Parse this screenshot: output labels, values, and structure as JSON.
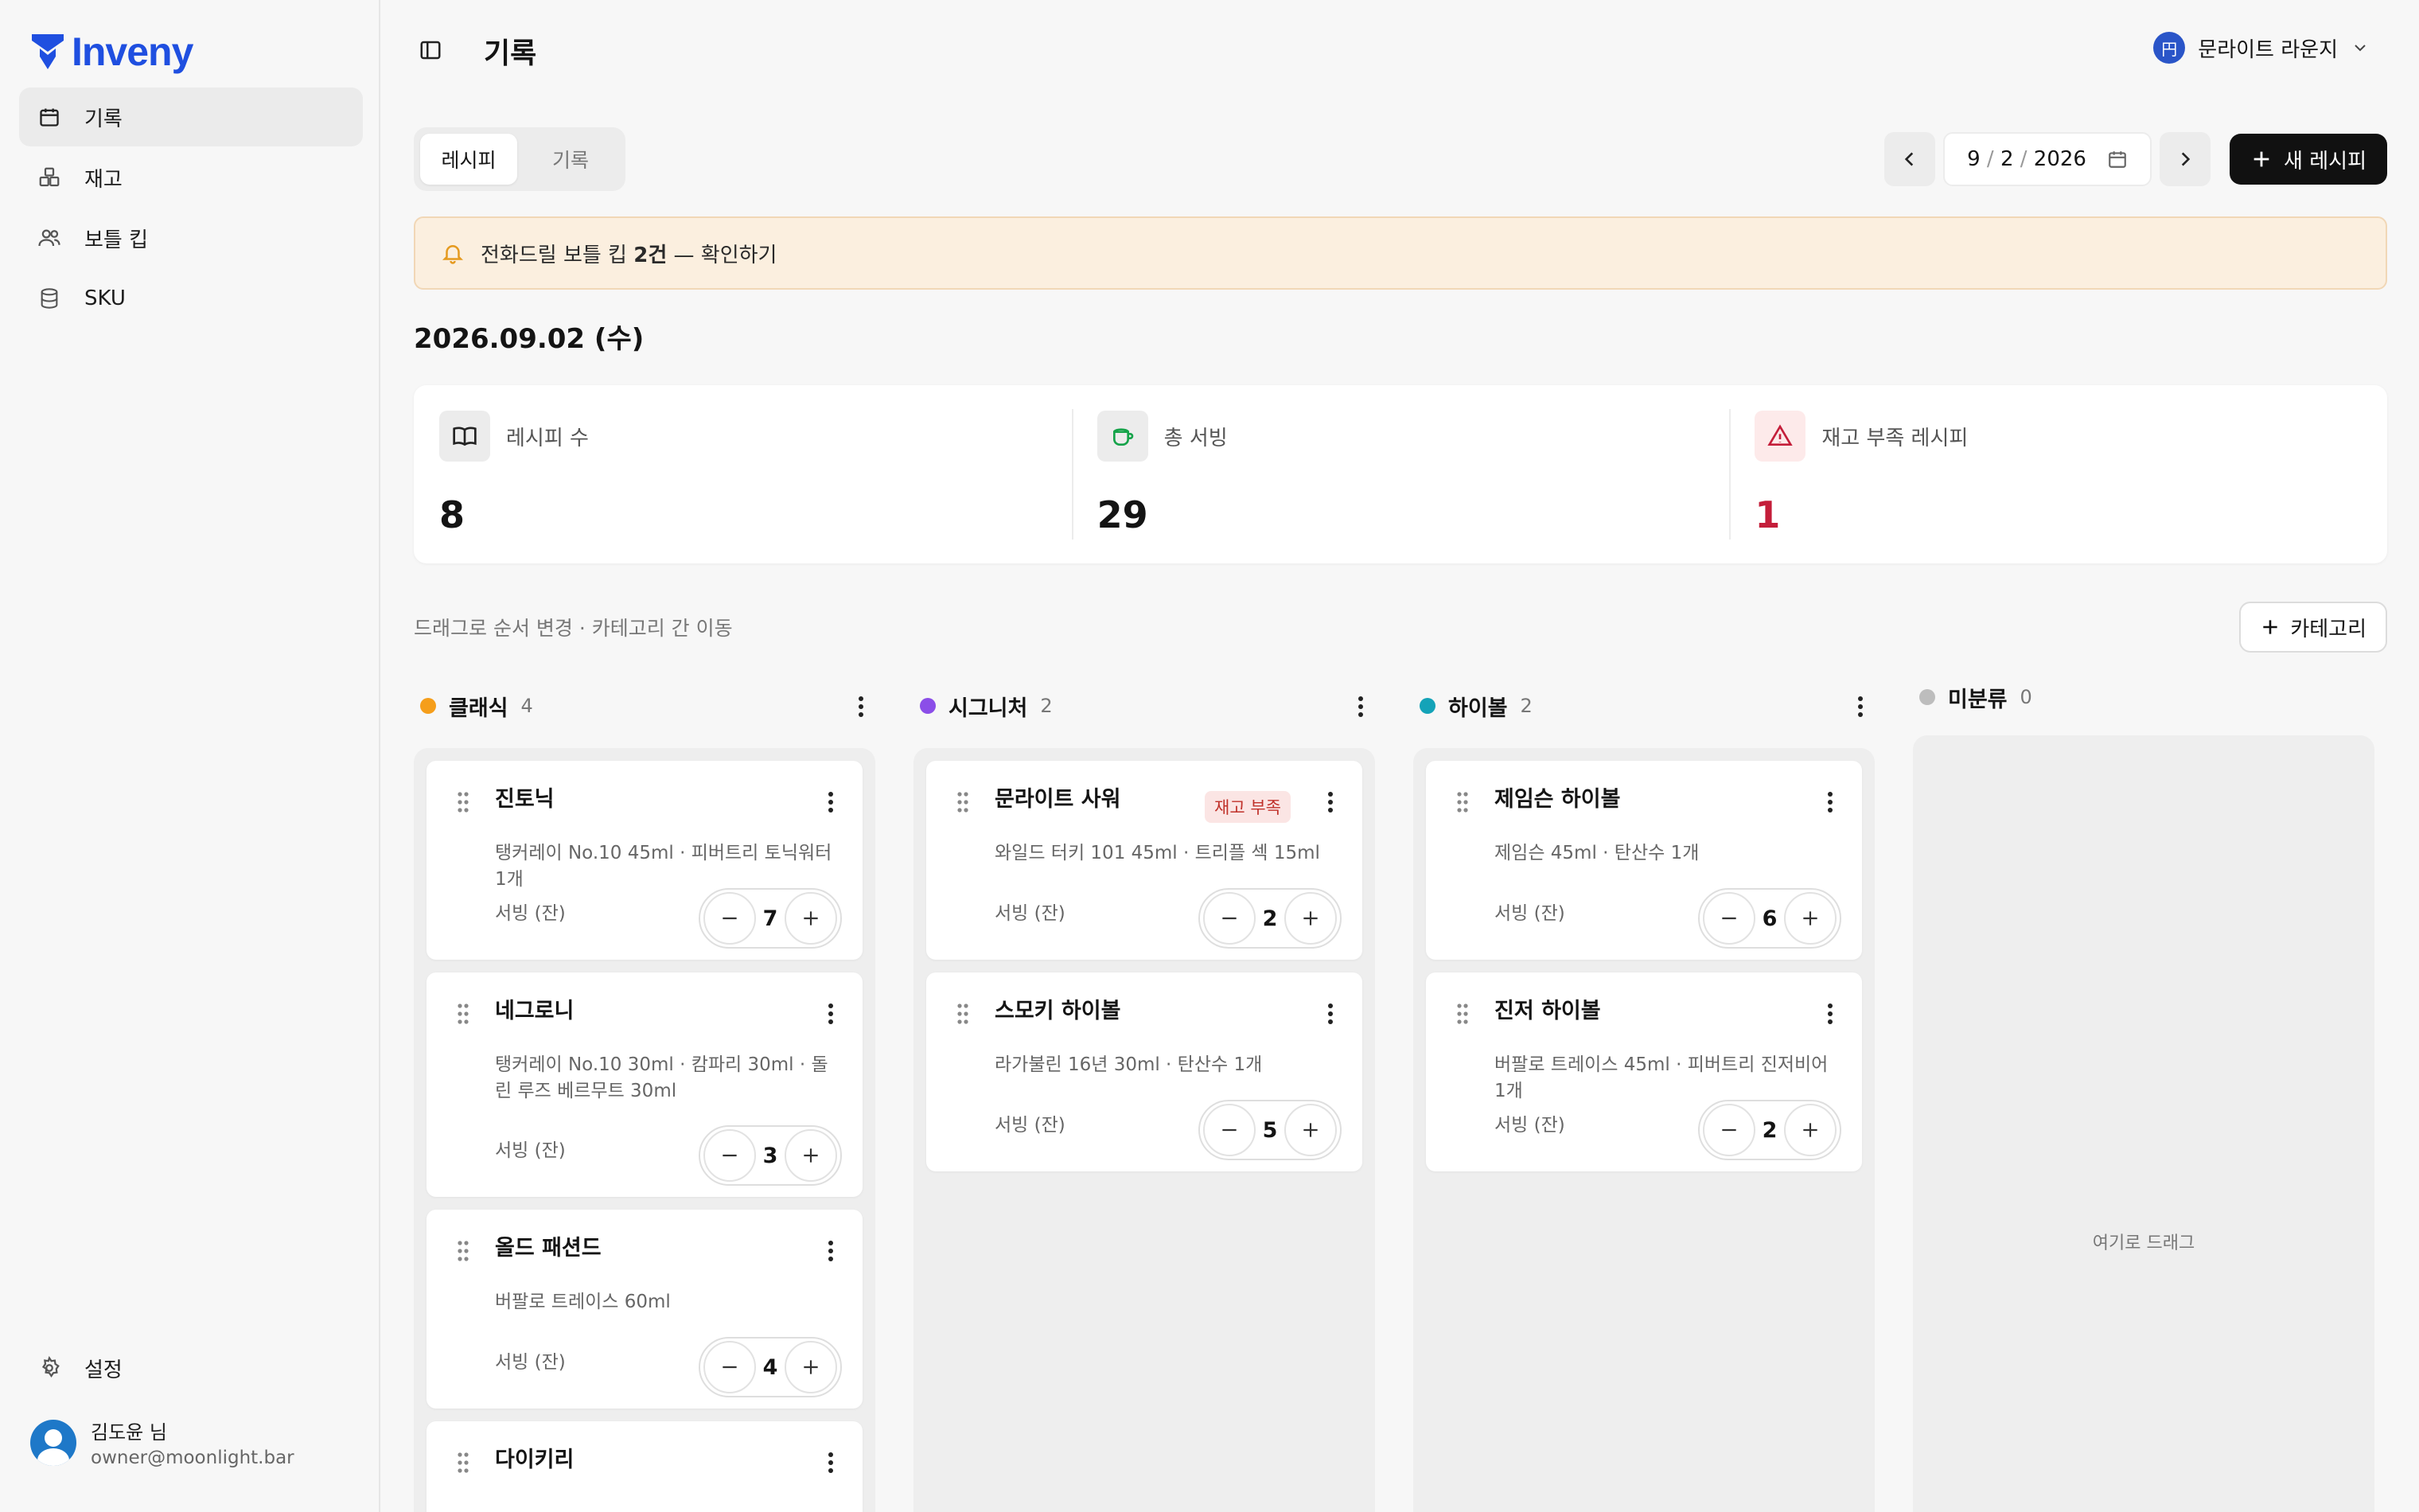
{
  "app": {
    "brand": "Inveny"
  },
  "sidebar": {
    "items": [
      {
        "label": "기록",
        "icon": "calendar-icon",
        "active": true
      },
      {
        "label": "재고",
        "icon": "boxes-icon",
        "active": false
      },
      {
        "label": "보틀 킵",
        "icon": "users-icon",
        "active": false
      },
      {
        "label": "SKU",
        "icon": "database-icon",
        "active": false
      }
    ],
    "settings_label": "설정",
    "user": {
      "name": "김도윤 님",
      "email": "owner@moonlight.bar"
    }
  },
  "header": {
    "title": "기록",
    "store": {
      "badge": "円",
      "name": "문라이트 라운지"
    }
  },
  "tabs": [
    {
      "label": "레시피",
      "active": true
    },
    {
      "label": "기록",
      "active": false
    }
  ],
  "date_picker": {
    "month": "9",
    "day": "2",
    "year": "2026"
  },
  "new_recipe_label": "새 레시피",
  "banner": {
    "prefix": "전화드릴 보틀 킵 ",
    "count": "2건",
    "suffix": " — 확인하기"
  },
  "date_heading": "2026.09.02 (수)",
  "stats": [
    {
      "label": "레시피 수",
      "value": "8",
      "icon": "book-icon"
    },
    {
      "label": "총 서빙",
      "value": "29",
      "icon": "cup-icon"
    },
    {
      "label": "재고 부족 레시피",
      "value": "1",
      "icon": "warning-icon"
    }
  ],
  "board_hint": "드래그로 순서 변경 · 카테고리 간 이동",
  "add_category_label": "카테고리",
  "serving_label": "서빙 (잔)",
  "colors": {
    "accent": "#111111",
    "brand": "#1f4fe0",
    "warning": "#c41e3a",
    "banner_bg": "#fbefdf"
  },
  "columns": [
    {
      "name": "클래식",
      "count": "4",
      "color": "#f59e1b",
      "cards": [
        {
          "name": "진토닉",
          "desc": "탱커레이 No.10 45ml · 피버트리 토닉워터 1개",
          "servings": "7"
        },
        {
          "name": "네그로니",
          "desc": "탱커레이 No.10 30ml · 캄파리 30ml · 돌린 루즈 베르무트 30ml",
          "servings": "3"
        },
        {
          "name": "올드 패션드",
          "desc": "버팔로 트레이스 60ml",
          "servings": "4"
        },
        {
          "name": "다이키리"
        }
      ]
    },
    {
      "name": "시그니처",
      "count": "2",
      "color": "#8b4ee8",
      "cards": [
        {
          "name": "문라이트 사워",
          "desc": "와일드 터키 101 45ml · 트리플 섹 15ml",
          "servings": "2",
          "badge": "재고 부족"
        },
        {
          "name": "스모키 하이볼",
          "desc": "라가불린 16년 30ml · 탄산수 1개",
          "servings": "5"
        }
      ]
    },
    {
      "name": "하이볼",
      "count": "2",
      "color": "#14a3b8",
      "cards": [
        {
          "name": "제임슨 하이볼",
          "desc": "제임슨 45ml · 탄산수 1개",
          "servings": "6"
        },
        {
          "name": "진저 하이볼",
          "desc": "버팔로 트레이스 45ml · 피버트리 진저비어 1개",
          "servings": "2"
        }
      ]
    },
    {
      "name": "미분류",
      "count": "0",
      "color": "#bdbdbd",
      "empty_hint": "여기로 드래그"
    }
  ]
}
